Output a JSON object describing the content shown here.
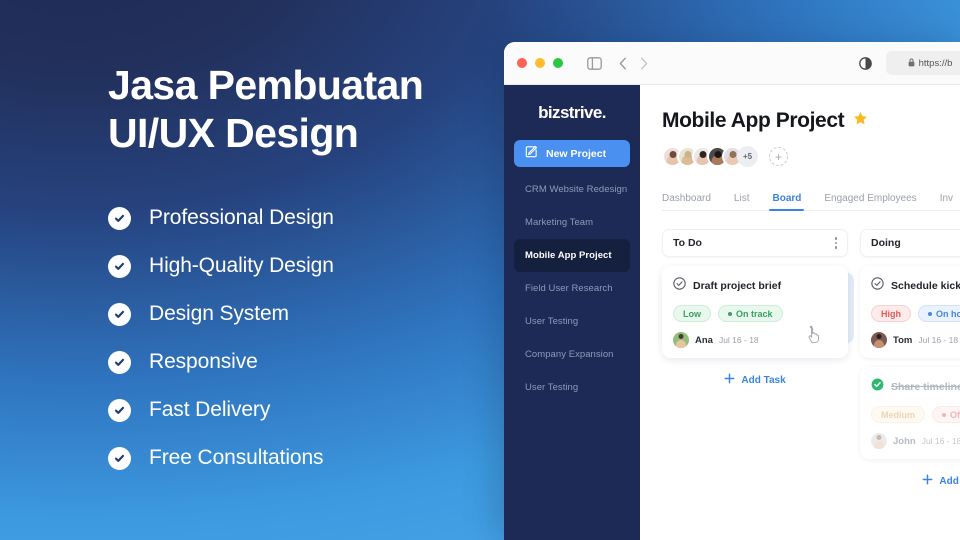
{
  "promo": {
    "title": "Jasa Pembuatan\nUI/UX Design",
    "features": [
      {
        "label": "Professional Design"
      },
      {
        "label": "High-Quality Design"
      },
      {
        "label": "Design System"
      },
      {
        "label": "Responsive"
      },
      {
        "label": "Fast Delivery"
      },
      {
        "label": "Free Consultations"
      }
    ]
  },
  "browser": {
    "url": "https://b",
    "traffic_lights": [
      "close",
      "minimize",
      "zoom"
    ],
    "icons": {
      "sidebar_toggle": "sidebar-toggle-icon",
      "back": "chevron-left-icon",
      "forward": "chevron-right-icon",
      "reader": "reader-contrast-icon",
      "lock": "lock-icon"
    }
  },
  "app": {
    "sidebar": {
      "brand": "bizstrive.",
      "new_project_label": "New Project",
      "items": [
        {
          "label": "CRM Website Redesign",
          "active": false
        },
        {
          "label": "Marketing Team",
          "active": false
        },
        {
          "label": "Mobile App Project",
          "active": true
        },
        {
          "label": "Field User Research",
          "active": false
        },
        {
          "label": "User Testing",
          "active": false
        },
        {
          "label": "Company Expansion",
          "active": false
        },
        {
          "label": "User Testing",
          "active": false
        }
      ]
    },
    "header": {
      "project_title": "Mobile App Project",
      "starred": true,
      "member_overflow": "+5",
      "add_member_label": "+",
      "avatar_colors": [
        {
          "bg": "#f0dcdc",
          "skin": "#e8c4ad",
          "hair": "#6b4b3c"
        },
        {
          "bg": "#e8e4d2",
          "skin": "#ddbb96",
          "hair": "#c9b48a"
        },
        {
          "bg": "#ece8ea",
          "skin": "#e6c4ae",
          "hair": "#2e2520"
        },
        {
          "bg": "#4a4a4a",
          "skin": "#a87a5c",
          "hair": "#1c1714"
        },
        {
          "bg": "#e2dde6",
          "skin": "#e9cbb4",
          "hair": "#8f7258"
        }
      ]
    },
    "tabs": [
      {
        "label": "Dashboard",
        "active": false
      },
      {
        "label": "List",
        "active": false
      },
      {
        "label": "Board",
        "active": true
      },
      {
        "label": "Engaged Employees",
        "active": false
      },
      {
        "label": "Inv",
        "active": false
      }
    ],
    "board": {
      "add_task_label": "Add Task",
      "columns": [
        {
          "title": "To Do",
          "cards": [
            {
              "title": "Draft project brief",
              "done": false,
              "priority": "Low",
              "priority_class": "prio-low",
              "status": "On track",
              "status_class": "st-ontrack",
              "assignee": "Ana",
              "date": "Jul 16 - 18",
              "avatar": {
                "bg": "#8fbf7a",
                "skin": "#e8c4a0",
                "hair": "#4a3a2c"
              }
            }
          ]
        },
        {
          "title": "Doing",
          "cards": [
            {
              "title": "Schedule kickoff",
              "done": false,
              "priority": "High",
              "priority_class": "prio-high",
              "status": "On hold",
              "status_class": "st-onhold",
              "assignee": "Tom",
              "date": "Jul 16 - 18",
              "avatar": {
                "bg": "#7a5a52",
                "skin": "#c49272",
                "hair": "#2b1f1a"
              }
            },
            {
              "title": "Share timeline wit",
              "done": true,
              "priority": "Medium",
              "priority_class": "prio-medium",
              "status": "Off track",
              "status_class": "st-offtrack",
              "assignee": "John",
              "date": "Jul 16 - 18",
              "avatar": {
                "bg": "#d8d4d0",
                "skin": "#e0c0a4",
                "hair": "#7a6a58"
              }
            }
          ]
        }
      ]
    }
  },
  "colors": {
    "accent_blue": "#3b82e8",
    "sidebar_navy": "#1c2a55",
    "button_blue": "#4a90f0",
    "star_gold": "#fcb81e",
    "done_green": "#2eb872"
  }
}
